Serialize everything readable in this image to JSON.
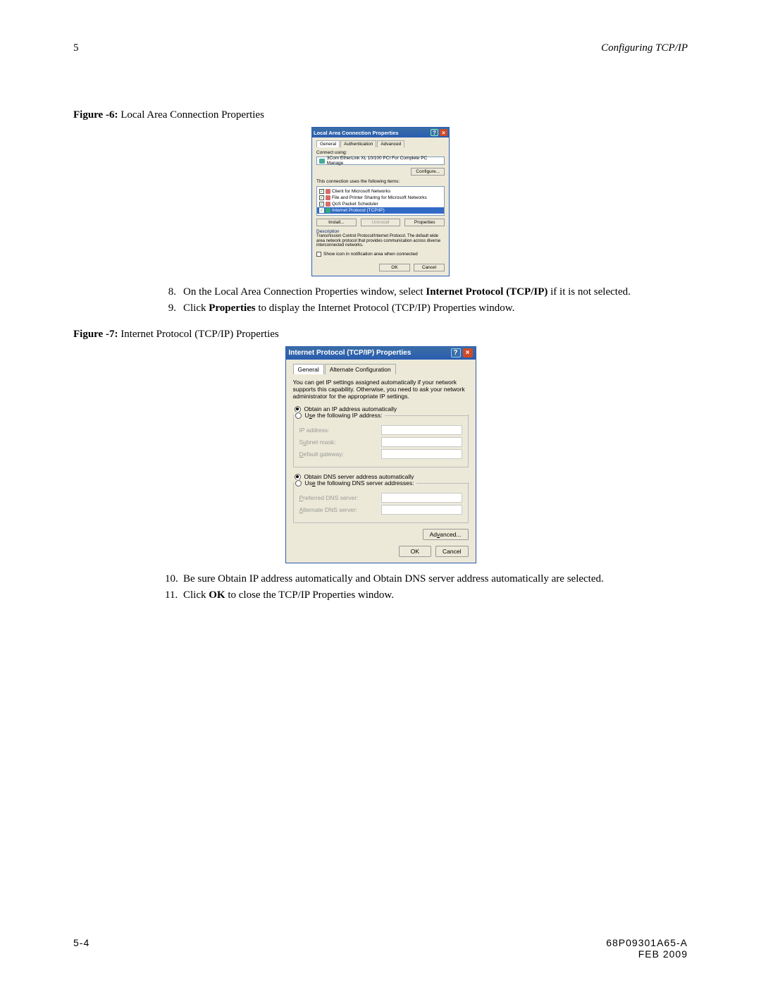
{
  "header": {
    "chapter": "5",
    "section": "Configuring TCP/IP"
  },
  "fig1": {
    "label": "Figure -6:",
    "caption": "Local Area Connection Properties"
  },
  "dlg1": {
    "title": "Local Area Connection Properties",
    "help": "?",
    "close": "×",
    "tabs": [
      "General",
      "Authentication",
      "Advanced"
    ],
    "connect_using": "Connect using:",
    "adapter": "3Com EtherLink XL 10/100 PCI For Complete PC Manage",
    "configure": "Configure...",
    "uses": "This connection uses the following items:",
    "items": [
      "Client for Microsoft Networks",
      "File and Printer Sharing for Microsoft Networks",
      "QoS Packet Scheduler",
      "Internet Protocol (TCP/IP)"
    ],
    "install": "Install...",
    "uninstall": "Uninstall",
    "properties": "Properties",
    "desc_h": "Description",
    "desc_t": "Transmission Control Protocol/Internet Protocol. The default wide area network protocol that provides communication across diverse interconnected networks.",
    "show": "Show icon in notification area when connected",
    "ok": "OK",
    "cancel": "Cancel"
  },
  "steps1": {
    "s8a": "On the Local Area Connection Properties window, select ",
    "s8b": "Internet Protocol (TCP/IP)",
    "s8c": " if it is not selected.",
    "s9a": "Click ",
    "s9b": "Properties",
    "s9c": " to display the Internet Protocol (TCP/IP) Properties window."
  },
  "fig2": {
    "label": "Figure -7:",
    "caption": "Internet Protocol (TCP/IP) Properties"
  },
  "dlg2": {
    "title": "Internet Protocol (TCP/IP) Properties",
    "help": "?",
    "close": "×",
    "tabs": [
      "General",
      "Alternate Configuration"
    ],
    "info": "You can get IP settings assigned automatically if your network supports this capability. Otherwise, you need to ask your network administrator for the appropriate IP settings.",
    "r_auto_ip": "Obtain an IP address automatically",
    "r_use_ip": "Use the following IP address:",
    "ip": "IP address:",
    "mask": "Subnet mask:",
    "gw": "Default gateway:",
    "r_auto_dns": "Obtain DNS server address automatically",
    "r_use_dns": "Use the following DNS server addresses:",
    "pdns": "Preferred DNS server:",
    "adns": "Alternate DNS server:",
    "advanced": "Advanced...",
    "ok": "OK",
    "cancel": "Cancel"
  },
  "steps2": {
    "s10": "Be sure Obtain IP address automatically and Obtain DNS server address automatically are selected.",
    "s11a": "Click ",
    "s11b": "OK",
    "s11c": " to close the TCP/IP Properties window."
  },
  "footer": {
    "left": "5-4",
    "rightA": "68P09301A65-A",
    "rightB": "FEB 2009"
  }
}
